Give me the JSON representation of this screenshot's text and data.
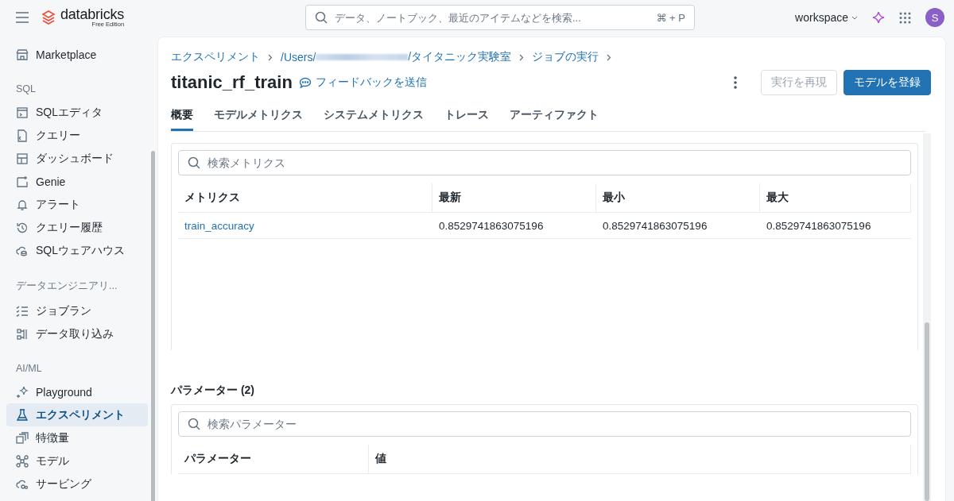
{
  "topbar": {
    "logo": "databricks",
    "edition": "Free Edition",
    "search": {
      "placeholder": "データ、ノートブック、最近のアイテムなどを検索...",
      "shortcut": "⌘ + P"
    },
    "workspace": "workspace",
    "avatar": "S"
  },
  "sidebar": {
    "sections": [
      {
        "items": [
          {
            "label": "Marketplace",
            "selected": false
          }
        ]
      },
      {
        "title": "SQL",
        "items": [
          {
            "label": "SQLエディタ",
            "selected": false
          },
          {
            "label": "クエリー",
            "selected": false
          },
          {
            "label": "ダッシュボード",
            "selected": false
          },
          {
            "label": "Genie",
            "selected": false
          },
          {
            "label": "アラート",
            "selected": false
          },
          {
            "label": "クエリー履歴",
            "selected": false
          },
          {
            "label": "SQLウェアハウス",
            "selected": false
          }
        ]
      },
      {
        "title": "データエンジニアリ...",
        "items": [
          {
            "label": "ジョブラン",
            "selected": false
          },
          {
            "label": "データ取り込み",
            "selected": false
          }
        ]
      },
      {
        "title": "AI/ML",
        "items": [
          {
            "label": "Playground",
            "selected": false
          },
          {
            "label": "エクスペリメント",
            "selected": true
          },
          {
            "label": "特徴量",
            "selected": false
          },
          {
            "label": "モデル",
            "selected": false
          },
          {
            "label": "サービング",
            "selected": false
          }
        ]
      }
    ]
  },
  "breadcrumb": [
    {
      "text": "エクスペリメント",
      "blurred": false
    },
    {
      "text": "/Users/",
      "blurred": true,
      "after": "/タイタニック実験室"
    },
    {
      "text": "ジョブの実行",
      "blurred": false
    }
  ],
  "title": "titanic_rf_train",
  "feedback": "フィードバックを送信",
  "buttons": [
    {
      "label": "実行を再現",
      "kind": "secondary"
    },
    {
      "label": "モデルを登録",
      "kind": "primary"
    }
  ],
  "tabs": [
    {
      "label": "概要",
      "selected": true
    },
    {
      "label": "モデルメトリクス",
      "selected": false
    },
    {
      "label": "システムメトリクス",
      "selected": false
    },
    {
      "label": "トレース",
      "selected": false
    },
    {
      "label": "アーティファクト",
      "selected": false
    }
  ],
  "metrics": {
    "search": {
      "placeholder": "検索メトリクス"
    },
    "columns": [
      "メトリクス",
      "最新",
      "最小",
      "最大"
    ],
    "rows": [
      [
        "train_accuracy",
        "0.8529741863075196",
        "0.8529741863075196",
        "0.8529741863075196"
      ]
    ]
  },
  "parameters": {
    "heading": "パラメーター (2)",
    "search": {
      "placeholder": "検索パラメーター"
    },
    "columns": [
      "パラメーター",
      "値"
    ]
  }
}
